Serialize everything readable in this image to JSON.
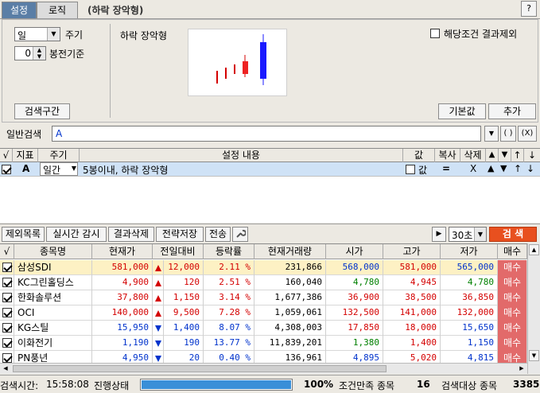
{
  "tabs": [
    {
      "label": "설정",
      "active": true
    },
    {
      "label": "로직",
      "active": false
    }
  ],
  "strategy_title": "(하락 장악형)",
  "help_label": "?",
  "settings": {
    "period_select": "일",
    "period_label": "주기",
    "offset_value": "0",
    "offset_label": "봉전기준",
    "pattern_label": "하락 장악형",
    "exclude_label": "해당조건 결과제외",
    "range_button": "검색구간",
    "default_button": "기본값",
    "add_button": "추가",
    "general_search_label": "일반검색",
    "general_search_value": "A",
    "paren_button": "( )",
    "x_paren_button": "(X)"
  },
  "condition_table": {
    "headers": [
      "√",
      "지표",
      "주기",
      "설정 내용",
      "값",
      "복사",
      "삭제",
      "▲",
      "▼",
      "↑",
      "↓"
    ],
    "rows": [
      {
        "checked": true,
        "indicator": "A",
        "period": "일간",
        "content": "5봉이내, 하락 장악형",
        "value_label": "값",
        "copy": "=",
        "delete": "X",
        "up": "▲",
        "down": "▼",
        "top": "↑",
        "bottom": "↓"
      }
    ]
  },
  "toolbar": {
    "buttons": [
      "제외목록",
      "실시간 감시",
      "결과삭제",
      "전략저장",
      "전송"
    ],
    "interval": "30초",
    "search_button": "검 색",
    "play_icon": "▶"
  },
  "results": {
    "headers": [
      "√",
      "종목명",
      "현재가",
      "전일대비",
      "등락률",
      "현재거래량",
      "시가",
      "고가",
      "저가",
      "매수"
    ],
    "rows": [
      {
        "name": "삼성SDI",
        "price": "581,000",
        "dir": "up",
        "change": "12,000",
        "rate": "2.11 %",
        "volume": "231,866",
        "open": "568,000",
        "high": "581,000",
        "low": "565,000",
        "buy": "매수",
        "price_color": "red",
        "open_color": "blue",
        "high_color": "red",
        "low_color": "blue",
        "highlight": true
      },
      {
        "name": "KC그린홀딩스",
        "price": "4,900",
        "dir": "up",
        "change": "120",
        "rate": "2.51 %",
        "volume": "160,040",
        "open": "4,780",
        "high": "4,945",
        "low": "4,780",
        "buy": "매수",
        "price_color": "red",
        "open_color": "green",
        "high_color": "red",
        "low_color": "green",
        "highlight": false
      },
      {
        "name": "한화솔루션",
        "price": "37,800",
        "dir": "up",
        "change": "1,150",
        "rate": "3.14 %",
        "volume": "1,677,386",
        "open": "36,900",
        "high": "38,500",
        "low": "36,850",
        "buy": "매수",
        "price_color": "red",
        "open_color": "red",
        "high_color": "red",
        "low_color": "red",
        "highlight": false
      },
      {
        "name": "OCI",
        "price": "140,000",
        "dir": "up",
        "change": "9,500",
        "rate": "7.28 %",
        "volume": "1,059,061",
        "open": "132,500",
        "high": "141,000",
        "low": "132,000",
        "buy": "매수",
        "price_color": "red",
        "open_color": "red",
        "high_color": "red",
        "low_color": "red",
        "highlight": false
      },
      {
        "name": "KG스틸",
        "price": "15,950",
        "dir": "down",
        "change": "1,400",
        "rate": "8.07 %",
        "volume": "4,308,003",
        "open": "17,850",
        "high": "18,000",
        "low": "15,650",
        "buy": "매수",
        "price_color": "blue",
        "open_color": "red",
        "high_color": "red",
        "low_color": "blue",
        "highlight": false
      },
      {
        "name": "이화전기",
        "price": "1,190",
        "dir": "down",
        "change": "190",
        "rate": "13.77 %",
        "volume": "11,839,201",
        "open": "1,380",
        "high": "1,400",
        "low": "1,150",
        "buy": "매수",
        "price_color": "blue",
        "open_color": "green",
        "high_color": "red",
        "low_color": "blue",
        "highlight": false
      },
      {
        "name": "PN풍년",
        "price": "4,950",
        "dir": "down",
        "change": "20",
        "rate": "0.40 %",
        "volume": "136,961",
        "open": "4,895",
        "high": "5,020",
        "low": "4,815",
        "buy": "매수",
        "price_color": "blue",
        "open_color": "blue",
        "high_color": "red",
        "low_color": "blue",
        "highlight": false
      }
    ]
  },
  "status": {
    "search_time_label": "검색시간:",
    "search_time": "15:58:08",
    "progress_label": "진행상태",
    "progress_percent": "100%",
    "progress_value": 100,
    "matched_label": "조건만족 종목",
    "matched_count": "16",
    "target_label": "검색대상 종목",
    "target_count": "3385"
  },
  "colors": {
    "tab_active": "#5a7ea6",
    "search_button": "#e8501f",
    "buy_cell": "#e26a6a",
    "progress": "#3a8fd8"
  }
}
